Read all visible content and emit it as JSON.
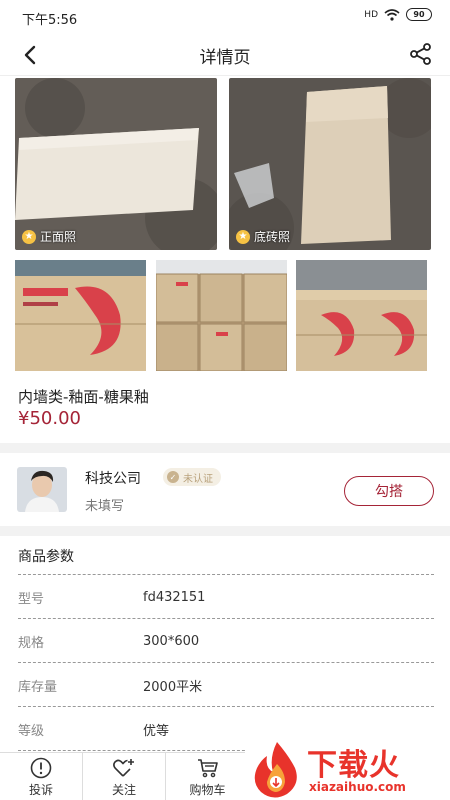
{
  "status_bar": {
    "time": "下午5:56",
    "signal": "HD",
    "battery": "90"
  },
  "nav": {
    "title": "详情页",
    "back_icon": "back-arrow-icon",
    "share_icon": "share-icon"
  },
  "photos": {
    "front_label": "正面照",
    "bottom_label": "底砖照",
    "star_glyph": "★"
  },
  "product": {
    "name": "内墙类-釉面-糖果釉",
    "price": "¥50.00"
  },
  "seller": {
    "name": "科技公司",
    "badge": "未认证",
    "subtitle": "未填写",
    "contact_label": "勾搭"
  },
  "params": {
    "title": "商品参数",
    "rows": [
      {
        "key": "型号",
        "value": "fd432151"
      },
      {
        "key": "规格",
        "value": "300*600"
      },
      {
        "key": "库存量",
        "value": "2000平米"
      },
      {
        "key": "等级",
        "value": "优等"
      }
    ]
  },
  "bottom_bar": {
    "complain": "投诉",
    "follow": "关注",
    "cart": "购物车"
  },
  "watermark": {
    "brand": "下载火",
    "domain": "xiazaihuo.com"
  },
  "colors": {
    "accent": "#a52437",
    "watermark": "#e8332b"
  }
}
